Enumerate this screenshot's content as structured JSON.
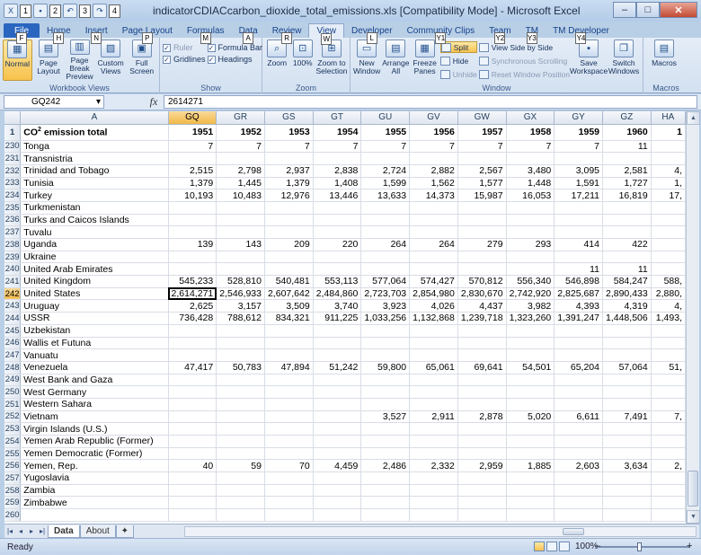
{
  "window": {
    "title": "indicatorCDIACcarbon_dioxide_total_emissions.xls  [Compatibility Mode] - Microsoft Excel",
    "qat_keytips": [
      "1",
      "2",
      "3",
      "4"
    ],
    "btn_minimize": "–",
    "btn_maximize": "□",
    "btn_close": "✕"
  },
  "tabs": [
    {
      "label": "File",
      "keytip": "F"
    },
    {
      "label": "Home",
      "keytip": "H"
    },
    {
      "label": "Insert",
      "keytip": "N"
    },
    {
      "label": "Page Layout",
      "keytip": "P"
    },
    {
      "label": "Formulas",
      "keytip": "M"
    },
    {
      "label": "Data",
      "keytip": "A"
    },
    {
      "label": "Review",
      "keytip": "R"
    },
    {
      "label": "View",
      "keytip": "W"
    },
    {
      "label": "Developer",
      "keytip": "L"
    },
    {
      "label": "Community Clips",
      "keytip": "Y1"
    },
    {
      "label": "Team",
      "keytip": "Y2"
    },
    {
      "label": "TM",
      "keytip": "Y3"
    },
    {
      "label": "TM Developer",
      "keytip": "Y4"
    }
  ],
  "ribbon": {
    "workbook_views": {
      "label": "Workbook Views",
      "normal": "Normal",
      "page_layout": "Page Layout",
      "page_break": "Page Break Preview",
      "custom_views": "Custom Views",
      "full_screen": "Full Screen"
    },
    "show": {
      "label": "Show",
      "ruler": "Ruler",
      "formula_bar": "Formula Bar",
      "gridlines": "Gridlines",
      "headings": "Headings"
    },
    "zoom": {
      "label": "Zoom",
      "zoom": "Zoom",
      "hundred": "100%",
      "to_selection": "Zoom to Selection"
    },
    "window": {
      "label": "Window",
      "new_window": "New Window",
      "arrange_all": "Arrange All",
      "freeze_panes": "Freeze Panes",
      "split": "Split",
      "hide": "Hide",
      "unhide": "Unhide",
      "side_by_side": "View Side by Side",
      "sync_scroll": "Synchronous Scrolling",
      "reset_position": "Reset Window Position",
      "save_workspace": "Save Workspace",
      "switch_windows": "Switch Windows"
    },
    "macros": {
      "label": "Macros",
      "macros": "Macros"
    }
  },
  "formula_bar": {
    "name_box": "GQ242",
    "fx": "fx",
    "value": "2614271"
  },
  "grid": {
    "columns": [
      "A",
      "GQ",
      "GR",
      "GS",
      "GT",
      "GU",
      "GV",
      "GW",
      "GX",
      "GY",
      "GZ",
      "HA"
    ],
    "header_row": {
      "num": "1",
      "label": "CO",
      "label_sup": "2",
      "label_rest": " emission total",
      "years": [
        "1951",
        "1952",
        "1953",
        "1954",
        "1955",
        "1956",
        "1957",
        "1958",
        "1959",
        "1960",
        "1"
      ]
    },
    "rows": [
      {
        "num": "230",
        "name": "Tonga",
        "v": [
          "7",
          "7",
          "7",
          "7",
          "7",
          "7",
          "7",
          "7",
          "7",
          "11",
          ""
        ]
      },
      {
        "num": "231",
        "name": "Transnistria",
        "v": [
          "",
          "",
          "",
          "",
          "",
          "",
          "",
          "",
          "",
          "",
          ""
        ]
      },
      {
        "num": "232",
        "name": "Trinidad and Tobago",
        "v": [
          "2,515",
          "2,798",
          "2,937",
          "2,838",
          "2,724",
          "2,882",
          "2,567",
          "3,480",
          "3,095",
          "2,581",
          "4,"
        ]
      },
      {
        "num": "233",
        "name": "Tunisia",
        "v": [
          "1,379",
          "1,445",
          "1,379",
          "1,408",
          "1,599",
          "1,562",
          "1,577",
          "1,448",
          "1,591",
          "1,727",
          "1,"
        ]
      },
      {
        "num": "234",
        "name": "Turkey",
        "v": [
          "10,193",
          "10,483",
          "12,976",
          "13,446",
          "13,633",
          "14,373",
          "15,987",
          "16,053",
          "17,211",
          "16,819",
          "17,"
        ]
      },
      {
        "num": "235",
        "name": "Turkmenistan",
        "v": [
          "",
          "",
          "",
          "",
          "",
          "",
          "",
          "",
          "",
          "",
          ""
        ]
      },
      {
        "num": "236",
        "name": "Turks and Caicos Islands",
        "v": [
          "",
          "",
          "",
          "",
          "",
          "",
          "",
          "",
          "",
          "",
          ""
        ]
      },
      {
        "num": "237",
        "name": "Tuvalu",
        "v": [
          "",
          "",
          "",
          "",
          "",
          "",
          "",
          "",
          "",
          "",
          ""
        ]
      },
      {
        "num": "238",
        "name": "Uganda",
        "v": [
          "139",
          "143",
          "209",
          "220",
          "264",
          "264",
          "279",
          "293",
          "414",
          "422",
          ""
        ]
      },
      {
        "num": "239",
        "name": "Ukraine",
        "v": [
          "",
          "",
          "",
          "",
          "",
          "",
          "",
          "",
          "",
          "",
          ""
        ]
      },
      {
        "num": "240",
        "name": "United Arab Emirates",
        "v": [
          "",
          "",
          "",
          "",
          "",
          "",
          "",
          "",
          "11",
          "11",
          ""
        ]
      },
      {
        "num": "241",
        "name": "United Kingdom",
        "v": [
          "545,233",
          "528,810",
          "540,481",
          "553,113",
          "577,064",
          "574,427",
          "570,812",
          "556,340",
          "546,898",
          "584,247",
          "588,"
        ]
      },
      {
        "num": "242",
        "name": "United States",
        "v": [
          "2,614,271",
          "2,546,933",
          "2,607,642",
          "2,484,860",
          "2,723,703",
          "2,854,980",
          "2,830,670",
          "2,742,920",
          "2,825,687",
          "2,890,433",
          "2,880,"
        ]
      },
      {
        "num": "243",
        "name": "Uruguay",
        "v": [
          "2,625",
          "3,157",
          "3,509",
          "3,740",
          "3,923",
          "4,026",
          "4,437",
          "3,982",
          "4,393",
          "4,319",
          "4,"
        ]
      },
      {
        "num": "244",
        "name": "USSR",
        "v": [
          "736,428",
          "788,612",
          "834,321",
          "911,225",
          "1,033,256",
          "1,132,868",
          "1,239,718",
          "1,323,260",
          "1,391,247",
          "1,448,506",
          "1,493,"
        ]
      },
      {
        "num": "245",
        "name": "Uzbekistan",
        "v": [
          "",
          "",
          "",
          "",
          "",
          "",
          "",
          "",
          "",
          "",
          ""
        ]
      },
      {
        "num": "246",
        "name": "Wallis et Futuna",
        "v": [
          "",
          "",
          "",
          "",
          "",
          "",
          "",
          "",
          "",
          "",
          ""
        ]
      },
      {
        "num": "247",
        "name": "Vanuatu",
        "v": [
          "",
          "",
          "",
          "",
          "",
          "",
          "",
          "",
          "",
          "",
          ""
        ]
      },
      {
        "num": "248",
        "name": "Venezuela",
        "v": [
          "47,417",
          "50,783",
          "47,894",
          "51,242",
          "59,800",
          "65,061",
          "69,641",
          "54,501",
          "65,204",
          "57,064",
          "51,"
        ]
      },
      {
        "num": "249",
        "name": "West Bank and Gaza",
        "v": [
          "",
          "",
          "",
          "",
          "",
          "",
          "",
          "",
          "",
          "",
          ""
        ]
      },
      {
        "num": "250",
        "name": "West Germany",
        "v": [
          "",
          "",
          "",
          "",
          "",
          "",
          "",
          "",
          "",
          "",
          ""
        ]
      },
      {
        "num": "251",
        "name": "Western Sahara",
        "v": [
          "",
          "",
          "",
          "",
          "",
          "",
          "",
          "",
          "",
          "",
          ""
        ]
      },
      {
        "num": "252",
        "name": "Vietnam",
        "v": [
          "",
          "",
          "",
          "",
          "3,527",
          "2,911",
          "2,878",
          "5,020",
          "6,611",
          "7,491",
          "7,"
        ]
      },
      {
        "num": "253",
        "name": "Virgin Islands (U.S.)",
        "v": [
          "",
          "",
          "",
          "",
          "",
          "",
          "",
          "",
          "",
          "",
          ""
        ]
      },
      {
        "num": "254",
        "name": "Yemen Arab Republic (Former)",
        "v": [
          "",
          "",
          "",
          "",
          "",
          "",
          "",
          "",
          "",
          "",
          ""
        ]
      },
      {
        "num": "255",
        "name": "Yemen Democratic (Former)",
        "v": [
          "",
          "",
          "",
          "",
          "",
          "",
          "",
          "",
          "",
          "",
          ""
        ]
      },
      {
        "num": "256",
        "name": "Yemen, Rep.",
        "v": [
          "40",
          "59",
          "70",
          "4,459",
          "2,486",
          "2,332",
          "2,959",
          "1,885",
          "2,603",
          "3,634",
          "2,"
        ]
      },
      {
        "num": "257",
        "name": "Yugoslavia",
        "v": [
          "",
          "",
          "",
          "",
          "",
          "",
          "",
          "",
          "",
          "",
          ""
        ]
      },
      {
        "num": "258",
        "name": "Zambia",
        "v": [
          "",
          "",
          "",
          "",
          "",
          "",
          "",
          "",
          "",
          "",
          ""
        ]
      },
      {
        "num": "259",
        "name": "Zimbabwe",
        "v": [
          "",
          "",
          "",
          "",
          "",
          "",
          "",
          "",
          "",
          "",
          ""
        ]
      },
      {
        "num": "260",
        "name": "",
        "v": [
          "",
          "",
          "",
          "",
          "",
          "",
          "",
          "",
          "",
          "",
          ""
        ]
      }
    ],
    "selected_row": "242",
    "selected_col": "GQ"
  },
  "sheets": {
    "tabs": [
      "Data",
      "About"
    ],
    "active": "Data"
  },
  "status": {
    "ready": "Ready",
    "zoom": "100%",
    "zoom_minus": "–",
    "zoom_plus": "+"
  },
  "colors": {
    "accent": "#2a66c0",
    "selection_header": "#f1b948"
  }
}
